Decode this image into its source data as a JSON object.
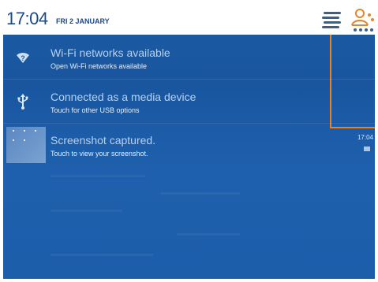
{
  "status_bar": {
    "time": "17:04",
    "date": "FRI 2 JANUARY"
  },
  "icons": {
    "quick_settings": "menu-lines-icon",
    "user": "user-icon"
  },
  "colors": {
    "panel_blue": "#1b5aa3",
    "highlight_orange": "#e8832a",
    "status_text": "#1d4a86"
  },
  "notifications": [
    {
      "icon": "wifi-question-icon",
      "title": "Wi-Fi networks available",
      "subtitle": "Open Wi-Fi networks available"
    },
    {
      "icon": "usb-icon",
      "title": "Connected as a media device",
      "subtitle": "Touch for other USB options"
    },
    {
      "icon": "screenshot-thumbnail",
      "title": "Screenshot captured.",
      "subtitle": "Touch to view your screenshot.",
      "time": "17:04"
    }
  ]
}
